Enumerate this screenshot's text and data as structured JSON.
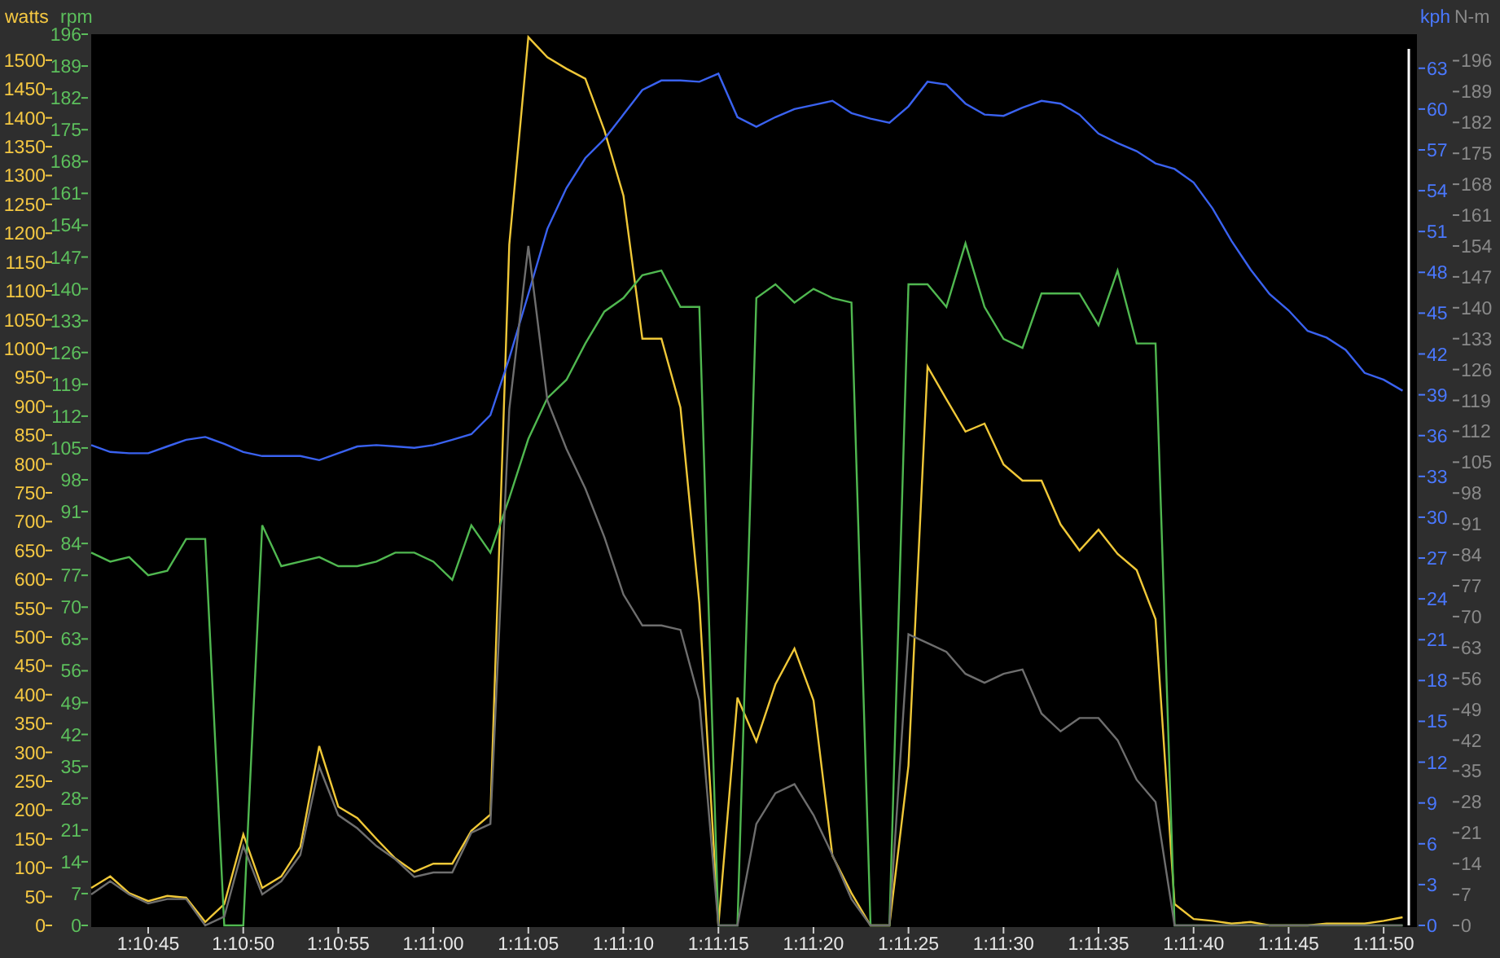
{
  "chart": {
    "layers": [
      {
        "chart_data": {
          "type": "line",
          "categories": [
            null,
            null,
            null,
            "1:10:45",
            null,
            null,
            null,
            null,
            "1:10:50",
            null,
            null,
            null,
            null,
            "1:10:55",
            null,
            null,
            null,
            null,
            "1:11:00",
            null,
            null,
            null,
            null,
            "1:11:05",
            null,
            null,
            null,
            null,
            "1:11:10",
            null,
            null,
            null,
            null,
            "1:11:15",
            null,
            null,
            null,
            null,
            "1:11:20",
            null,
            null,
            null,
            null,
            "1:11:25",
            null,
            null,
            null,
            null,
            "1:11:30",
            null,
            null,
            null,
            null,
            "1:11:35",
            null,
            null,
            null,
            null,
            "1:11:40",
            null,
            null,
            null,
            null,
            "1:11:45",
            null,
            null,
            null,
            null,
            "1:11:50",
            null
          ],
          "ylim": [
            0,
            1545
          ],
          "yticks": [
            1500,
            1450,
            1400,
            1350,
            1300,
            1250,
            1200,
            1150,
            1100,
            1050,
            1000,
            950,
            900,
            850,
            800,
            750,
            700,
            650,
            600,
            550,
            500,
            450,
            400,
            350,
            300,
            250,
            200,
            150,
            100,
            50,
            0
          ],
          "series": [
            {
              "name": "watts",
              "color": "#f0c838",
              "values": [
                65,
                85,
                56,
                42,
                51,
                48,
                6,
                37,
                158,
                65,
                85,
                136,
                311,
                206,
                186,
                150,
                116,
                93,
                107,
                107,
                164,
                192,
                1180,
                1540,
                1505,
                1485,
                1468,
                1378,
                1265,
                1017,
                1017,
                898,
                559,
                0,
                395,
                319,
                418,
                480,
                390,
                121,
                56,
                0,
                0,
                277,
                969,
                912,
                856,
                870,
                799,
                771,
                771,
                695,
                650,
                686,
                644,
                616,
                531,
                37,
                11,
                8,
                3,
                6,
                0,
                0,
                0,
                3,
                3,
                3,
                8,
                14
              ]
            }
          ]
        }
      },
      {
        "chart_data": {
          "type": "line",
          "ylim": [
            0,
            196
          ],
          "yticks": [
            196,
            189,
            182,
            175,
            168,
            161,
            154,
            147,
            140,
            133,
            126,
            119,
            112,
            105,
            98,
            91,
            84,
            77,
            70,
            63,
            56,
            49,
            42,
            35,
            28,
            21,
            14,
            7,
            0
          ],
          "series": [
            {
              "name": "rpm",
              "color": "#50b850",
              "values": [
                82,
                80,
                81,
                77,
                78,
                85,
                85,
                0,
                0,
                88,
                79,
                80,
                81,
                79,
                79,
                80,
                82,
                82,
                80,
                76,
                88,
                82,
                94,
                107,
                116,
                120,
                128,
                135,
                138,
                143,
                144,
                136,
                136,
                0,
                0,
                138,
                141,
                137,
                140,
                138,
                137,
                0,
                0,
                141,
                141,
                136,
                150,
                136,
                129,
                127,
                139,
                139,
                139,
                132,
                144,
                128,
                128,
                0,
                0,
                0,
                0,
                0,
                0,
                0,
                0,
                0,
                0,
                0,
                0,
                0
              ]
            }
          ]
        }
      },
      {
        "chart_data": {
          "type": "line",
          "ylim": [
            0,
            65.5
          ],
          "yticks": [
            63,
            60,
            57,
            54,
            51,
            48,
            45,
            42,
            39,
            36,
            33,
            30,
            27,
            24,
            21,
            18,
            15,
            12,
            9,
            6,
            3,
            0
          ],
          "series": [
            {
              "name": "kph",
              "color": "#3a62f0",
              "values": [
                35.3,
                34.8,
                34.7,
                34.7,
                35.2,
                35.7,
                35.9,
                35.4,
                34.8,
                34.5,
                34.5,
                34.5,
                34.2,
                34.7,
                35.2,
                35.3,
                35.2,
                35.1,
                35.3,
                35.7,
                36.1,
                37.5,
                41.7,
                46.4,
                51.2,
                54.2,
                56.4,
                57.8,
                59.6,
                61.4,
                62.1,
                62.1,
                62.0,
                62.6,
                59.4,
                58.7,
                59.4,
                60.0,
                60.3,
                60.6,
                59.7,
                59.3,
                59.0,
                60.2,
                62.0,
                61.8,
                60.4,
                59.6,
                59.5,
                60.1,
                60.6,
                60.4,
                59.6,
                58.2,
                57.5,
                56.9,
                56.0,
                55.6,
                54.6,
                52.7,
                50.3,
                48.2,
                46.4,
                45.2,
                43.7,
                43.2,
                42.3,
                40.6,
                40.1,
                39.3
              ]
            }
          ]
        }
      },
      {
        "chart_data": {
          "type": "line",
          "ylim": [
            0,
            202
          ],
          "yticks": [
            196,
            189,
            182,
            175,
            168,
            161,
            154,
            147,
            140,
            133,
            126,
            119,
            112,
            105,
            98,
            91,
            84,
            77,
            70,
            63,
            56,
            49,
            42,
            35,
            28,
            21,
            14,
            7,
            0
          ],
          "series": [
            {
              "name": "N-m",
              "color": "#6e6e6e",
              "values": [
                7,
                10,
                7,
                5,
                6,
                6,
                0,
                2,
                18,
                7,
                10,
                16,
                36,
                25,
                22,
                18,
                15,
                11,
                12,
                12,
                21,
                23,
                117,
                154,
                119,
                108,
                99,
                88,
                75,
                68,
                68,
                67,
                51,
                0,
                0,
                23,
                30,
                32,
                25,
                16,
                6,
                0,
                0,
                66,
                64,
                62,
                57,
                55,
                57,
                58,
                48,
                44,
                47,
                47,
                42,
                33,
                28,
                0,
                0,
                0,
                0,
                0,
                0,
                0,
                0,
                0,
                0,
                0,
                0,
                0
              ]
            }
          ]
        }
      }
    ]
  }
}
